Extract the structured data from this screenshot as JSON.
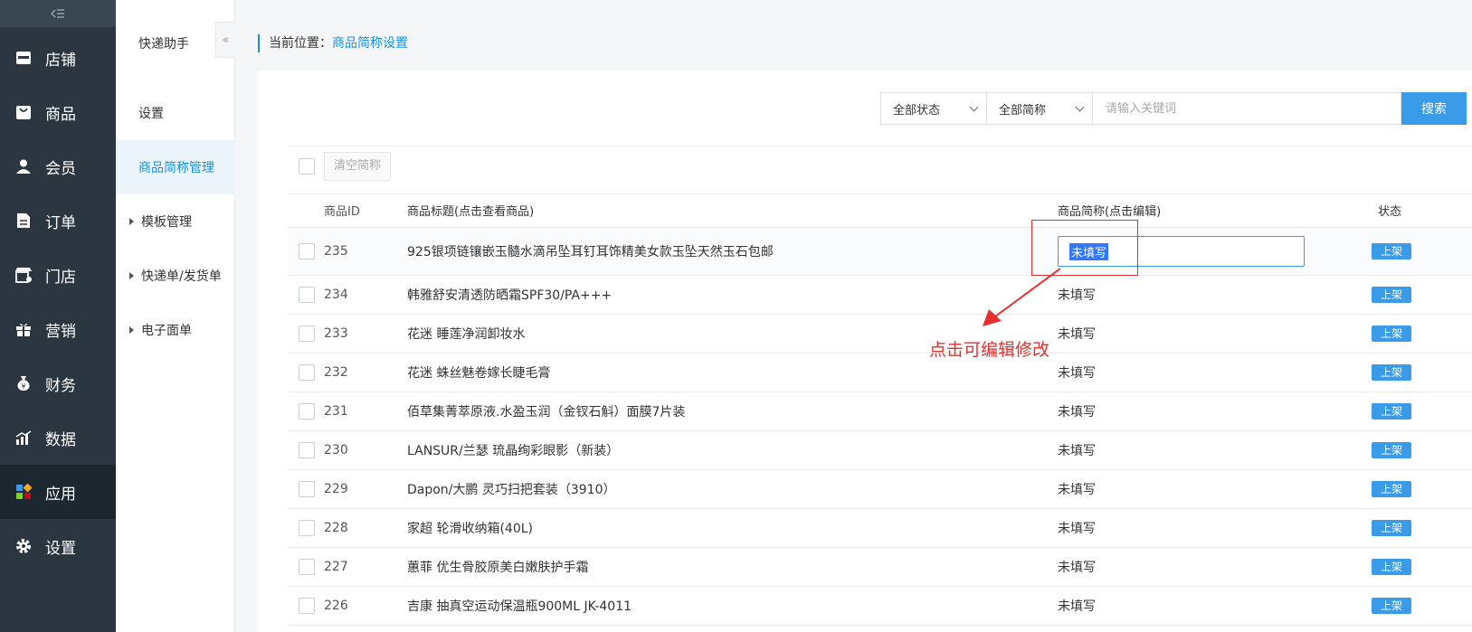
{
  "main_nav": {
    "items": [
      {
        "label": "店铺",
        "icon": "store-icon",
        "active": false
      },
      {
        "label": "商品",
        "icon": "bag-icon",
        "active": false
      },
      {
        "label": "会员",
        "icon": "user-icon",
        "active": false
      },
      {
        "label": "订单",
        "icon": "document-icon",
        "active": false
      },
      {
        "label": "门店",
        "icon": "shop-front-icon",
        "active": false
      },
      {
        "label": "营销",
        "icon": "gift-icon",
        "active": false
      },
      {
        "label": "财务",
        "icon": "money-bag-icon",
        "active": false
      },
      {
        "label": "数据",
        "icon": "bar-chart-icon",
        "active": false
      },
      {
        "label": "应用",
        "icon": "apps-grid-icon",
        "active": true
      },
      {
        "label": "设置",
        "icon": "gear-icon",
        "active": false
      }
    ]
  },
  "sub_nav": {
    "title": "快递助手",
    "items": [
      {
        "label": "设置",
        "active": false,
        "expandable": false
      },
      {
        "label": "商品简称管理",
        "active": true,
        "expandable": false
      },
      {
        "label": "模板管理",
        "active": false,
        "expandable": true
      },
      {
        "label": "快递单/发货单",
        "active": false,
        "expandable": true
      },
      {
        "label": "电子面单",
        "active": false,
        "expandable": true
      }
    ]
  },
  "breadcrumb": {
    "prefix": "当前位置：",
    "current": "商品简称设置"
  },
  "search": {
    "status_select": "全部状态",
    "abbr_select": "全部简称",
    "placeholder": "请输入关键词",
    "button": "搜索"
  },
  "toolbar": {
    "clear_label": "清空简称"
  },
  "table": {
    "headers": {
      "id": "商品ID",
      "title": "商品标题(点击查看商品)",
      "abbr": "商品简称(点击编辑)",
      "status": "状态"
    },
    "rows": [
      {
        "id": "235",
        "title": "925银项链镶嵌玉髓水滴吊坠耳钉耳饰精美女款玉坠天然玉石包邮",
        "abbr": "未填写",
        "status": "上架"
      },
      {
        "id": "234",
        "title": "韩雅舒安清透防晒霜SPF30/PA+++",
        "abbr": "未填写",
        "status": "上架"
      },
      {
        "id": "233",
        "title": "花迷 睡莲净润卸妆水",
        "abbr": "未填写",
        "status": "上架"
      },
      {
        "id": "232",
        "title": "花迷 蛛丝魅卷嫁长睫毛膏",
        "abbr": "未填写",
        "status": "上架"
      },
      {
        "id": "231",
        "title": "佰草集菁萃原液.水盈玉润（金钗石斛）面膜7片装",
        "abbr": "未填写",
        "status": "上架"
      },
      {
        "id": "230",
        "title": "LANSUR/兰瑟 琉晶绚彩眼影（新装）",
        "abbr": "未填写",
        "status": "上架"
      },
      {
        "id": "229",
        "title": "Dapon/大鹏 灵巧扫把套装（3910）",
        "abbr": "未填写",
        "status": "上架"
      },
      {
        "id": "228",
        "title": "家超 轮滑收纳箱(40L)",
        "abbr": "未填写",
        "status": "上架"
      },
      {
        "id": "227",
        "title": "蕙菲 优生骨胶原美白嫩肤护手霜",
        "abbr": "未填写",
        "status": "上架"
      },
      {
        "id": "226",
        "title": "吉康 抽真空运动保温瓶900ML JK-4011",
        "abbr": "未填写",
        "status": "上架"
      }
    ]
  },
  "annotation": {
    "text": "点击可编辑修改",
    "color": "#e5302e"
  },
  "colors": {
    "accent": "#3a9be8",
    "sidebar_bg": "#2b3640",
    "link": "#1e90dc"
  }
}
